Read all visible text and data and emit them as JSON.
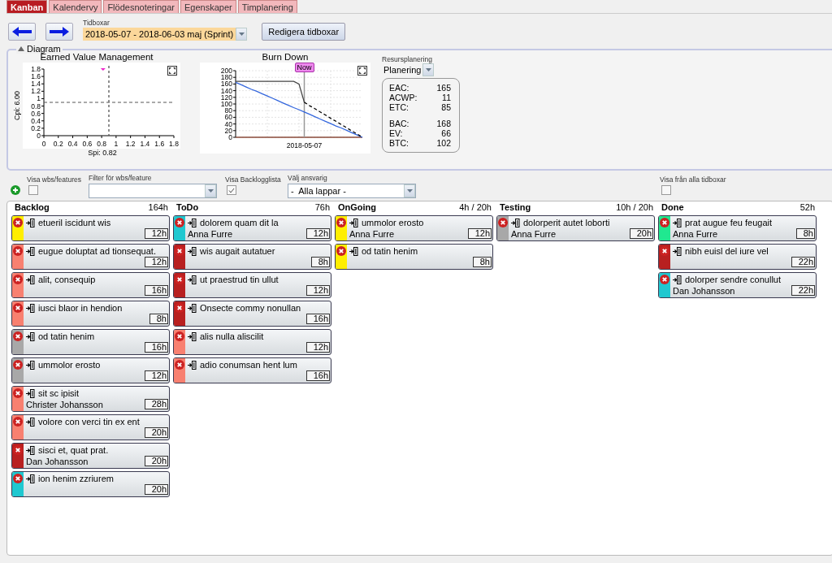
{
  "tabs": [
    {
      "label": "Kanban",
      "selected": true
    },
    {
      "label": "Kalendervy",
      "selected": false
    },
    {
      "label": "Flödesnoteringar",
      "selected": false
    },
    {
      "label": "Egenskaper",
      "selected": false
    },
    {
      "label": "Timplanering",
      "selected": false
    }
  ],
  "timebox": {
    "label": "Tidboxar",
    "value": "2018-05-07 - 2018-06-03 maj (Sprint)",
    "edit_button": "Redigera tidboxar"
  },
  "diagram": {
    "title": "Diagram",
    "expanded": true,
    "evm": {
      "chart_data": {
        "type": "scatter",
        "title": "Earned Value Management",
        "xlabel": "Spi: 0.82",
        "ylabel": "Cpi: 6.00",
        "xlim": [
          0,
          1.8
        ],
        "ylim": [
          0,
          1.8
        ],
        "xticks": [
          0,
          0.2,
          0.4,
          0.6,
          0.8,
          1,
          1.2,
          1.4,
          1.6,
          1.8
        ],
        "yticks": [
          0,
          0.2,
          0.4,
          0.6,
          0.8,
          1,
          1.2,
          1.4,
          1.6,
          1.8
        ],
        "series": [
          {
            "color": "#ee22cc",
            "x": [
              0.82
            ],
            "values": [
              1.8
            ]
          }
        ],
        "ref_lines": [
          {
            "axis": "y",
            "value": 0.9
          },
          {
            "axis": "x",
            "value": 0.9
          }
        ]
      }
    },
    "burndown": {
      "chart_data": {
        "type": "line",
        "title": "Burn Down",
        "ylim": [
          0,
          200
        ],
        "grid": true,
        "yticks": [
          0,
          20,
          40,
          60,
          80,
          100,
          120,
          140,
          160,
          180,
          200
        ],
        "series": [
          {
            "color": "#3366dd",
            "values": [
              165,
              158,
              151,
              144,
              138,
              131,
              124,
              117,
              110,
              103,
              96,
              89,
              83,
              76,
              69,
              62,
              55,
              48,
              41,
              34,
              28,
              21,
              14,
              7,
              0
            ]
          },
          {
            "color": "#444444",
            "values": [
              168,
              168,
              168,
              168,
              168,
              168,
              168,
              168,
              168,
              168,
              168,
              168,
              160,
              105,
              null,
              null,
              null,
              null,
              null,
              null,
              null,
              null,
              null,
              null,
              null
            ]
          },
          {
            "color": "#000000",
            "line_style": "dashed",
            "values": [
              null,
              null,
              null,
              null,
              null,
              null,
              null,
              null,
              null,
              null,
              null,
              null,
              null,
              105,
              95,
              86,
              76,
              67,
              57,
              48,
              38,
              29,
              19,
              10,
              0
            ]
          }
        ],
        "annotations": [
          "Now",
          "2018-05-07"
        ]
      }
    },
    "resource": {
      "label": "Resursplanering",
      "value": "Planering",
      "stats": [
        [
          {
            "label": "EAC:",
            "value": "165"
          },
          {
            "label": "ACWP:",
            "value": "11"
          },
          {
            "label": "ETC:",
            "value": "85"
          }
        ],
        [
          {
            "label": "BAC:",
            "value": "168"
          },
          {
            "label": "EV:",
            "value": "66"
          },
          {
            "label": "BTC:",
            "value": "102"
          }
        ]
      ]
    }
  },
  "filters": {
    "show_wbs": {
      "label": "Visa wbs/features",
      "checked": false
    },
    "wbs_filter": {
      "label": "Filter för wbs/feature"
    },
    "show_backlog": {
      "label": "Visa Backlogglista",
      "checked": true
    },
    "responsible": {
      "label": "Välj ansvarig",
      "value": "-  Alla lappar -"
    },
    "show_all": {
      "label": "Visa från alla tidboxar",
      "checked": false
    }
  },
  "columns": [
    {
      "name": "Backlog",
      "total": "164h",
      "cards": [
        {
          "title": "etueril iscidunt wis",
          "hours": "12h",
          "color": "#ffee00"
        },
        {
          "title": "eugue doluptat ad tionsequat.",
          "hours": "12h",
          "color": "#f88070"
        },
        {
          "title": "alit, consequip",
          "hours": "16h",
          "color": "#f88070"
        },
        {
          "title": "iusci blaor in hendion",
          "hours": "8h",
          "color": "#f88070"
        },
        {
          "title": "od tatin henim",
          "hours": "16h",
          "color": "#a8a8a8"
        },
        {
          "title": "ummolor erosto",
          "hours": "12h",
          "color": "#a8a8a8"
        },
        {
          "title": "sit sc ipisit",
          "assignee": "Christer Johansson",
          "hours": "28h",
          "color": "#f88070"
        },
        {
          "title": "volore con verci tin ex ent",
          "hours": "20h",
          "color": "#f88070"
        },
        {
          "title": "sisci et, quat prat.",
          "assignee": "Dan Johansson",
          "hours": "20h",
          "color": "#b82020"
        },
        {
          "title": "ion henim zzriurem",
          "hours": "20h",
          "color": "#20c8d0"
        }
      ]
    },
    {
      "name": "ToDo",
      "total": "76h",
      "cards": [
        {
          "title": "dolorem quam dit la",
          "assignee": "Anna Furre",
          "hours": "12h",
          "color": "#20c8d0"
        },
        {
          "title": "wis augait autatuer",
          "hours": "8h",
          "color": "#b82020"
        },
        {
          "title": "ut praestrud tin ullut",
          "hours": "12h",
          "color": "#b82020"
        },
        {
          "title": "Onsecte commy nonullan",
          "hours": "16h",
          "color": "#b82020"
        },
        {
          "title": "alis nulla aliscilit",
          "hours": "12h",
          "color": "#f88070"
        },
        {
          "title": "adio conumsan hent lum",
          "hours": "16h",
          "color": "#f88070"
        }
      ]
    },
    {
      "name": "OnGoing",
      "total": "4h / 20h",
      "cards": [
        {
          "title": "ummolor erosto",
          "assignee": "Anna Furre",
          "hours": "12h",
          "color": "#ffee00"
        },
        {
          "title": "od tatin henim",
          "hours": "8h",
          "color": "#ffee00"
        }
      ]
    },
    {
      "name": "Testing",
      "total": "10h / 20h",
      "cards": [
        {
          "title": "dolorperit autet loborti",
          "assignee": "Anna Furre",
          "hours": "20h",
          "color": "#a8a8a8"
        }
      ]
    },
    {
      "name": "Done",
      "total": "52h",
      "cards": [
        {
          "title": "prat augue feu feugait",
          "assignee": "Anna Furre",
          "hours": "8h",
          "color": "#20e890"
        },
        {
          "title": "nibh euisl del iure vel",
          "hours": "22h",
          "color": "#b82020"
        },
        {
          "title": "dolorper sendre conullut",
          "assignee": "Dan Johansson",
          "hours": "22h",
          "color": "#20c8d0"
        }
      ]
    }
  ]
}
